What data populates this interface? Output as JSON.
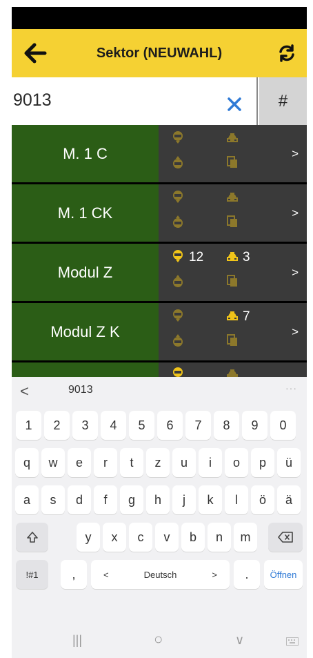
{
  "header": {
    "title": "Sektor (NEUWAHL)",
    "back_icon": "arrow-left-icon",
    "refresh_icon": "refresh-icon",
    "color": "#f5d133"
  },
  "search": {
    "value": "9013",
    "clear_icon": "close-icon",
    "hash_label": "#"
  },
  "sectors": [
    {
      "name": "M. 1 C",
      "pin_count": "",
      "taxi_count": "",
      "chevron": ">"
    },
    {
      "name": "M. 1 CK",
      "pin_count": "",
      "taxi_count": "",
      "chevron": ">"
    },
    {
      "name": "Modul Z",
      "pin_count": "12",
      "taxi_count": "3",
      "chevron": ">"
    },
    {
      "name": "Modul Z K",
      "pin_count": "",
      "taxi_count": "7",
      "chevron": ">"
    }
  ],
  "colors": {
    "sector_green": "#2b5d16",
    "info_dark": "#3a3a3a",
    "icon_yellow": "#f0c419",
    "suggestion_blue": "#2f7ad6"
  },
  "keyboard": {
    "suggestion": "9013",
    "back_label": "<",
    "dots_label": "···",
    "row_numbers": [
      "1",
      "2",
      "3",
      "4",
      "5",
      "6",
      "7",
      "8",
      "9",
      "0"
    ],
    "row_1": [
      "q",
      "w",
      "e",
      "r",
      "t",
      "z",
      "u",
      "i",
      "o",
      "p",
      "ü"
    ],
    "row_2": [
      "a",
      "s",
      "d",
      "f",
      "g",
      "h",
      "j",
      "k",
      "l",
      "ö",
      "ä"
    ],
    "row_3": [
      "y",
      "x",
      "c",
      "v",
      "b",
      "n",
      "m"
    ],
    "shift_icon": "shift-icon",
    "backspace_icon": "backspace-icon",
    "symbols_label": "!#1",
    "comma_label": ",",
    "lang_left": "<",
    "language_label": "Deutsch",
    "lang_right": ">",
    "period_label": ".",
    "action_label": "Öffnen"
  },
  "nav": {
    "recent_label": "|||",
    "home_label": "○",
    "back_label": "∨",
    "keyboard_icon": "keyboard-icon"
  }
}
